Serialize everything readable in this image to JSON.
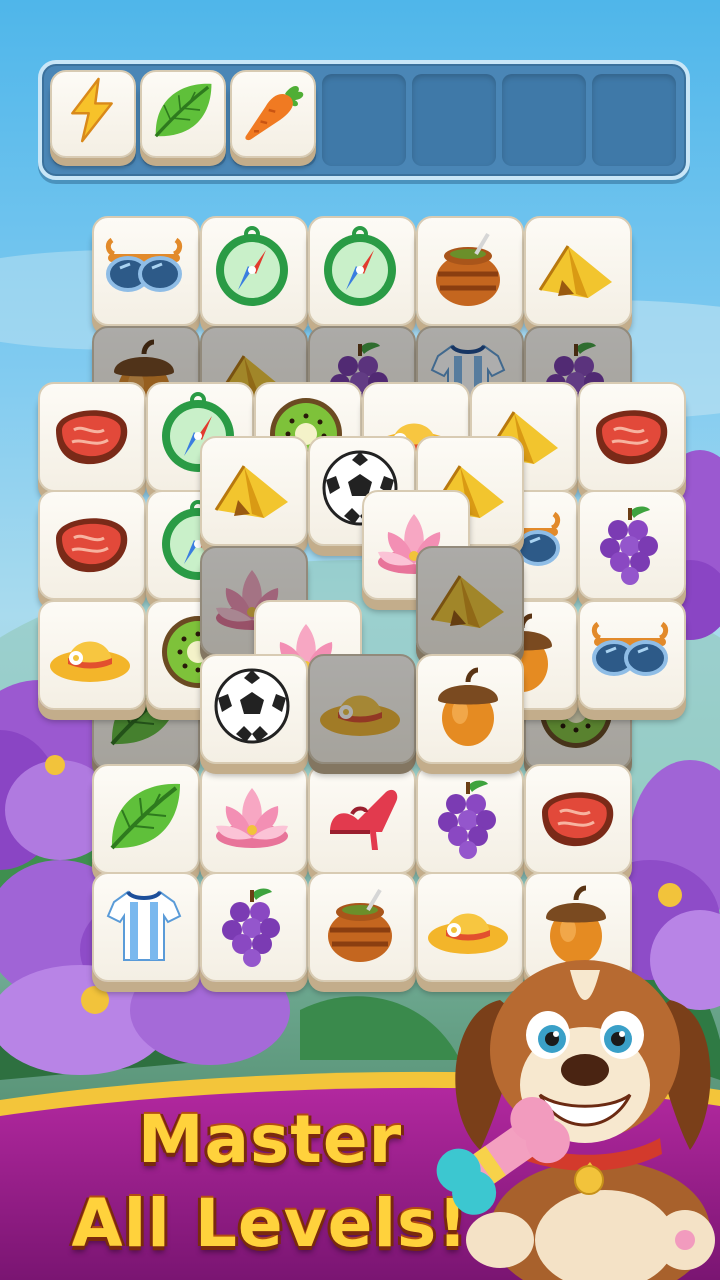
{
  "game": {
    "headline": {
      "line1": "Master",
      "line2": "All Levels!"
    }
  },
  "tray": {
    "capacity": 7,
    "tiles": [
      "lightning-bolt",
      "leaf",
      "carrot"
    ]
  },
  "board": {
    "rows": [
      [
        "sunglasses",
        "compass",
        "compass",
        "honey-pot",
        "tent"
      ],
      [
        "acorn",
        "tent",
        "grapes",
        "soccer-jersey",
        "grapes"
      ],
      [
        "steak",
        "compass",
        "kiwi",
        "sun-hat",
        "tent",
        "steak"
      ],
      [
        "steak",
        "compass",
        "sunglasses",
        "grapes"
      ],
      [
        "sun-hat",
        "kiwi",
        "acorn",
        "sunglasses"
      ],
      [
        "leaf",
        "lotus",
        "high-heel",
        "grapes",
        "steak"
      ],
      [
        "soccer-jersey",
        "grapes",
        "honey-pot",
        "sun-hat",
        "acorn"
      ]
    ],
    "top_layer": [
      "tent",
      "soccer-ball",
      "tent",
      "lotus",
      "lotus",
      "tent",
      "lotus",
      "soccer-ball",
      "sun-hat",
      "acorn"
    ]
  },
  "mascot": "puppy-with-bone",
  "colors": {
    "sky": "#4fb6ea",
    "tray": "#4a86b6",
    "banner": "#9a1f8c",
    "headline": "#ffd23c",
    "tile_face": "#fdfbf6"
  }
}
